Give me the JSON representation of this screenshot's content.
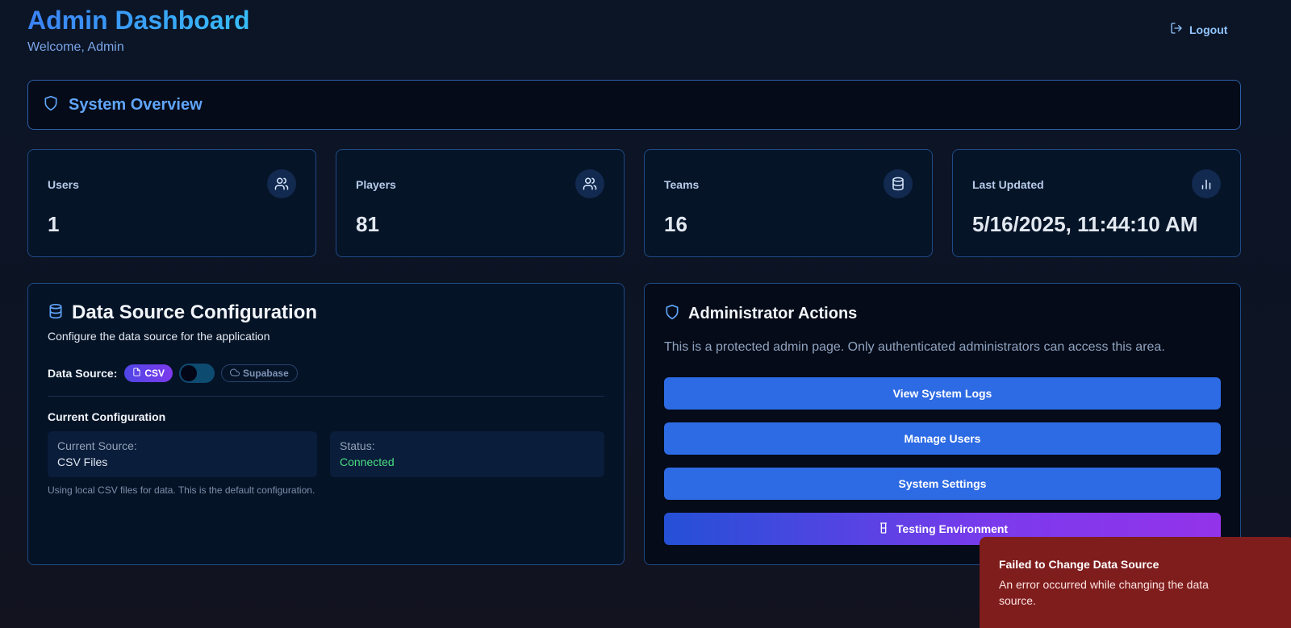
{
  "header": {
    "title": "Admin Dashboard",
    "welcome": "Welcome, Admin",
    "logout_label": "Logout"
  },
  "overview": {
    "title": "System Overview"
  },
  "stats": [
    {
      "label": "Users",
      "value": "1",
      "icon": "users-icon"
    },
    {
      "label": "Players",
      "value": "81",
      "icon": "users-icon"
    },
    {
      "label": "Teams",
      "value": "16",
      "icon": "database-icon"
    },
    {
      "label": "Last Updated",
      "value": "5/16/2025, 11:44:10 AM",
      "icon": "bar-chart-icon"
    }
  ],
  "data_source": {
    "title": "Data Source Configuration",
    "subtitle": "Configure the data source for the application",
    "label": "Data Source:",
    "option_csv": "CSV",
    "option_supabase": "Supabase",
    "toggle_on": false,
    "current_config_title": "Current Configuration",
    "current_source_label": "Current Source:",
    "current_source_value": "CSV Files",
    "status_label": "Status:",
    "status_value": "Connected",
    "note": "Using local CSV files for data. This is the default configuration."
  },
  "admin_actions": {
    "title": "Administrator Actions",
    "description": "This is a protected admin page. Only authenticated administrators can access this area.",
    "buttons": {
      "logs": "View System Logs",
      "users": "Manage Users",
      "settings": "System Settings",
      "testing": "Testing Environment"
    }
  },
  "toast": {
    "title": "Failed to Change Data Source",
    "message": "An error occurred while changing the data source."
  },
  "colors": {
    "accent": "#3b82f6",
    "success": "#4ade80",
    "error_bg": "#7f1d1d",
    "button": "#2d6be4"
  }
}
